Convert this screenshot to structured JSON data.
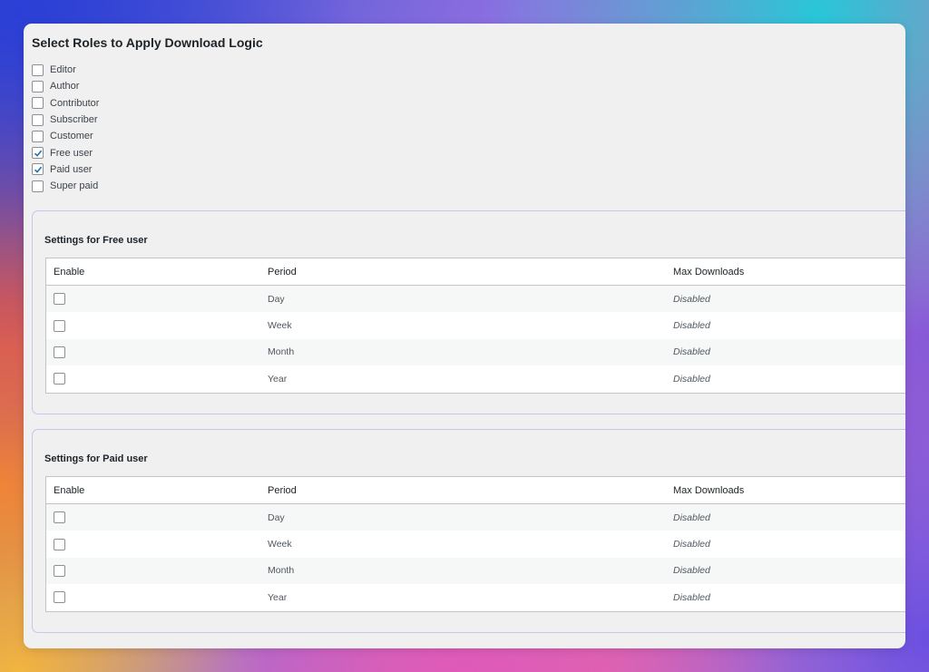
{
  "title": "Select Roles to Apply Download Logic",
  "roles": [
    {
      "label": "Editor",
      "checked": false
    },
    {
      "label": "Author",
      "checked": false
    },
    {
      "label": "Contributor",
      "checked": false
    },
    {
      "label": "Subscriber",
      "checked": false
    },
    {
      "label": "Customer",
      "checked": false
    },
    {
      "label": "Free user",
      "checked": true
    },
    {
      "label": "Paid user",
      "checked": true
    },
    {
      "label": "Super paid",
      "checked": false
    }
  ],
  "panels": [
    {
      "title": "Settings for Free user",
      "headers": {
        "enable": "Enable",
        "period": "Period",
        "max": "Max Downloads"
      },
      "rows": [
        {
          "period": "Day",
          "max": "Disabled",
          "enabled": false
        },
        {
          "period": "Week",
          "max": "Disabled",
          "enabled": false
        },
        {
          "period": "Month",
          "max": "Disabled",
          "enabled": false
        },
        {
          "period": "Year",
          "max": "Disabled",
          "enabled": false
        }
      ]
    },
    {
      "title": "Settings for Paid user",
      "headers": {
        "enable": "Enable",
        "period": "Period",
        "max": "Max Downloads"
      },
      "rows": [
        {
          "period": "Day",
          "max": "Disabled",
          "enabled": false
        },
        {
          "period": "Week",
          "max": "Disabled",
          "enabled": false
        },
        {
          "period": "Month",
          "max": "Disabled",
          "enabled": false
        },
        {
          "period": "Year",
          "max": "Disabled",
          "enabled": false
        }
      ]
    }
  ],
  "colors": {
    "checkmark": "#2271b1",
    "panel_border": "#c9c3ee",
    "window_bg": "#f0f0f1"
  }
}
